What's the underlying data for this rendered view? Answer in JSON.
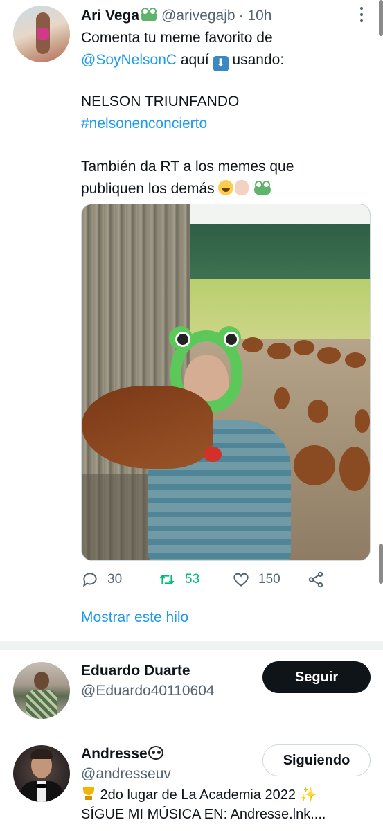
{
  "tweet": {
    "author_name": "Ari Vega",
    "author_handle": "@arivegajb",
    "time": "· 10h",
    "text_line1": "Comenta tu meme favorito de",
    "mention": "@SoyNelsonC",
    "text_line2_after": " aquí ",
    "text_line2_end": " usando:",
    "text_line3": "NELSON TRIUNFANDO",
    "hashtag": "#nelsonenconcierto",
    "text_line4": "También da RT a los memes que",
    "text_line5": "publiquen los demás ",
    "reply_count": "30",
    "retweet_count": "53",
    "like_count": "150",
    "show_thread": "Mostrar este hilo"
  },
  "suggestions": [
    {
      "name": "Eduardo Duarte",
      "handle": "@Eduardo40110604",
      "button": "Seguir"
    },
    {
      "name": "Andresse",
      "handle": "@andresseuv",
      "button": "Siguiendo",
      "bio_line1": " 2do lugar de La Academia 2022 ",
      "bio_line2": "SÍGUE MI MÚSICA EN: Andresse.lnk...."
    }
  ],
  "colors": {
    "link": "#1d9bf0",
    "retweet_active": "#00ba7c",
    "follow_button_bg": "#0f1419"
  },
  "icons": [
    "more-icon",
    "reply-icon",
    "retweet-icon",
    "like-icon",
    "share-icon"
  ]
}
